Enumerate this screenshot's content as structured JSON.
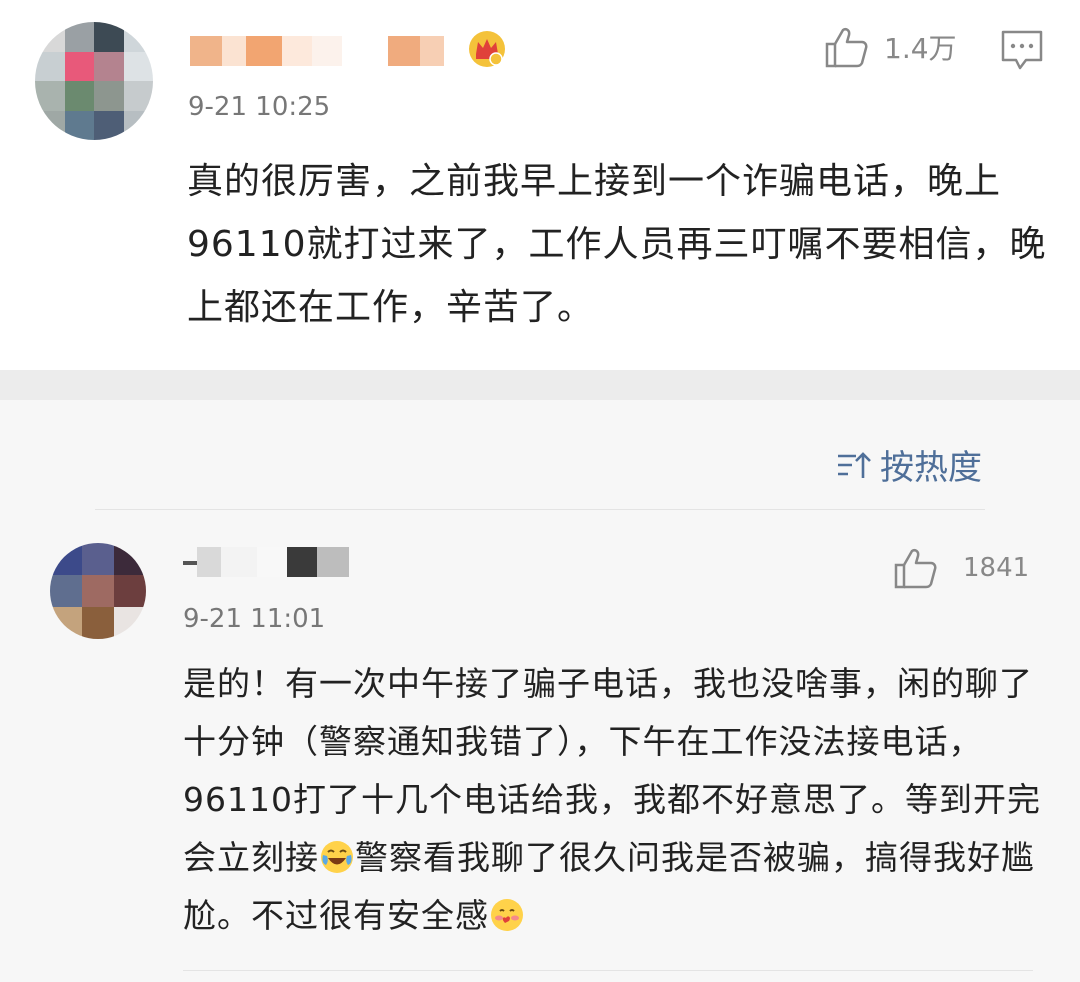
{
  "comment_main": {
    "username_hidden": true,
    "badge_icon": "crown-badge-icon",
    "date": "9-21 10:25",
    "like_count": "1.4万",
    "text": "真的很厉害，之前我早上接到一个诈骗电话，晚上96110就打过来了，工作人员再三叮嘱不要相信，晚上都还在工作，辛苦了。"
  },
  "sort": {
    "icon": "sort-icon",
    "label": "按热度"
  },
  "reply": {
    "username_hidden": true,
    "date": "9-21 11:01",
    "like_count": "1841",
    "text_part1": "是的！有一次中午接了骗子电话，我也没啥事，闲的聊了十分钟（警察通知我错了），下午在工作没法接电话，96110打了十几个电话给我，我都不好意思了。等到开完会立刻接",
    "emoji1": "laughing-crying-emoji",
    "text_part2": "警察看我聊了很久问我是否被骗，搞得我好尴尬。不过很有安全感",
    "emoji2": "blush-heart-emoji"
  },
  "colors": {
    "accent": "#4f6f99",
    "separator": "#ececec",
    "secondary_bg": "#f7f7f7"
  }
}
